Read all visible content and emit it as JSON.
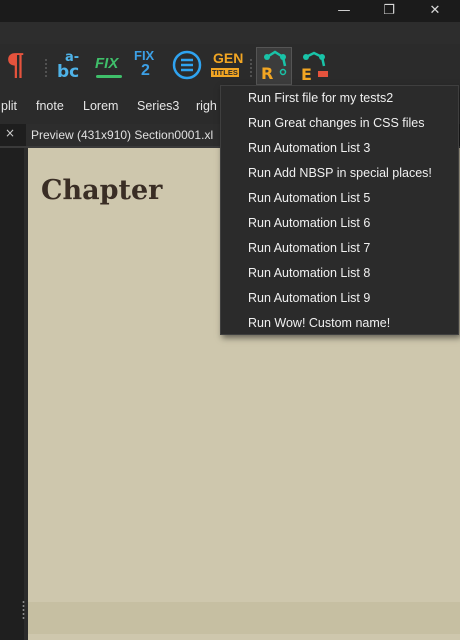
{
  "window": {
    "min_glyph": "—",
    "restore_glyph": "❐",
    "close_glyph": "✕"
  },
  "toolbar": {
    "icons": [
      {
        "name": "pilcrow-icon",
        "glyph": "¶",
        "color": "#e5533d"
      },
      {
        "name": "spellcheck-icon",
        "top": "a-",
        "bottom": "bc",
        "color": "#4fb3e8",
        "accent": "#e98b2f"
      },
      {
        "name": "fix-icon",
        "text": "FIX",
        "color": "#3fbf6a"
      },
      {
        "name": "fix2-icon",
        "text": "FIX",
        "num": "2",
        "color": "#3ca0e6",
        "accent": "#f2b233"
      },
      {
        "name": "list-icon",
        "color": "#2fa3f0"
      },
      {
        "name": "gen-titles-icon",
        "text": "GEN",
        "sub": "TITLES",
        "color": "#f2a623"
      },
      {
        "name": "run-automation-r-icon",
        "letter": "R",
        "color": "#f2a623",
        "accent": "#19c3a8"
      },
      {
        "name": "edit-automation-e-icon",
        "letter": "E",
        "color": "#f2a623",
        "accent": "#e5533d"
      }
    ]
  },
  "clipbar": {
    "items": [
      "plit",
      "fnote",
      "Lorem",
      "Series3",
      "righ"
    ]
  },
  "tab": {
    "close_glyph": "×",
    "label": "Preview (431x910) Section0001.xl"
  },
  "preview": {
    "heading": "Chapter"
  },
  "menu": {
    "items": [
      "Run First file for my tests2",
      "Run Great changes in CSS files",
      "Run Automation List 3",
      "Run Add NBSP in special places!",
      "Run Automation List 5",
      "Run Automation List 6",
      "Run Automation List 7",
      "Run Automation List 8",
      "Run Automation List 9",
      "Run Wow! Custom name!"
    ]
  }
}
